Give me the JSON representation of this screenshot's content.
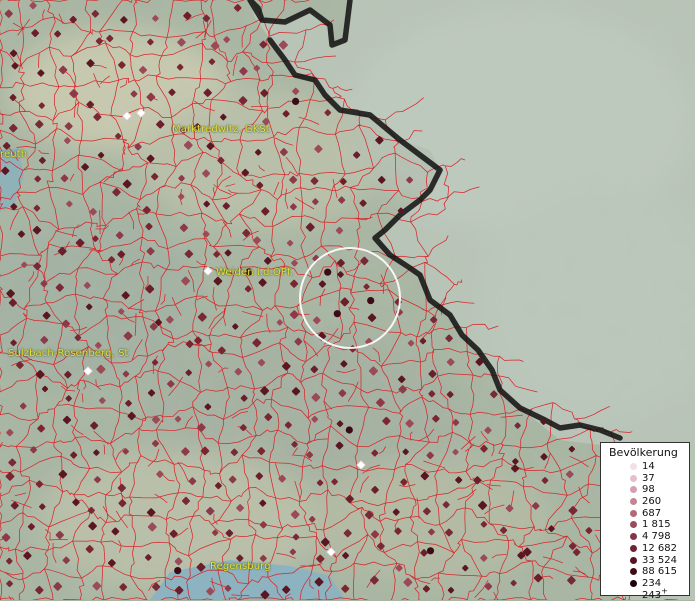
{
  "map": {
    "background": "#a7b5a1",
    "border_color": "#111111",
    "district_line_color": "#d6272b",
    "settlement_color": "#7a2630",
    "place_labels": [
      {
        "id": "reuth",
        "text": "reuth"
      },
      {
        "id": "marktredwitz",
        "text": "Marktredwitz, GKSt"
      },
      {
        "id": "weiden",
        "text": "Weiden i.d.OPf."
      },
      {
        "id": "sulzbach",
        "text": "Sulzbach-Rosenberg, St"
      },
      {
        "id": "regensburg",
        "text": "Regensburg"
      }
    ]
  },
  "legend": {
    "title": "Bevölkerung",
    "items": [
      {
        "label": "14",
        "color": "#f3dfe6"
      },
      {
        "label": "37",
        "color": "#e6bfca"
      },
      {
        "label": "98",
        "color": "#d4a0b0"
      },
      {
        "label": "260",
        "color": "#c28696"
      },
      {
        "label": "687",
        "color": "#b06a7a"
      },
      {
        "label": "1 815",
        "color": "#9a4c5d"
      },
      {
        "label": "4 798",
        "color": "#853646"
      },
      {
        "label": "12 682",
        "color": "#6e2433"
      },
      {
        "label": "33 524",
        "color": "#561623"
      },
      {
        "label": "88 615",
        "color": "#3c0c16"
      },
      {
        "label": "234 243",
        "color": "#1c040a"
      }
    ],
    "overflow_marker": "+"
  }
}
